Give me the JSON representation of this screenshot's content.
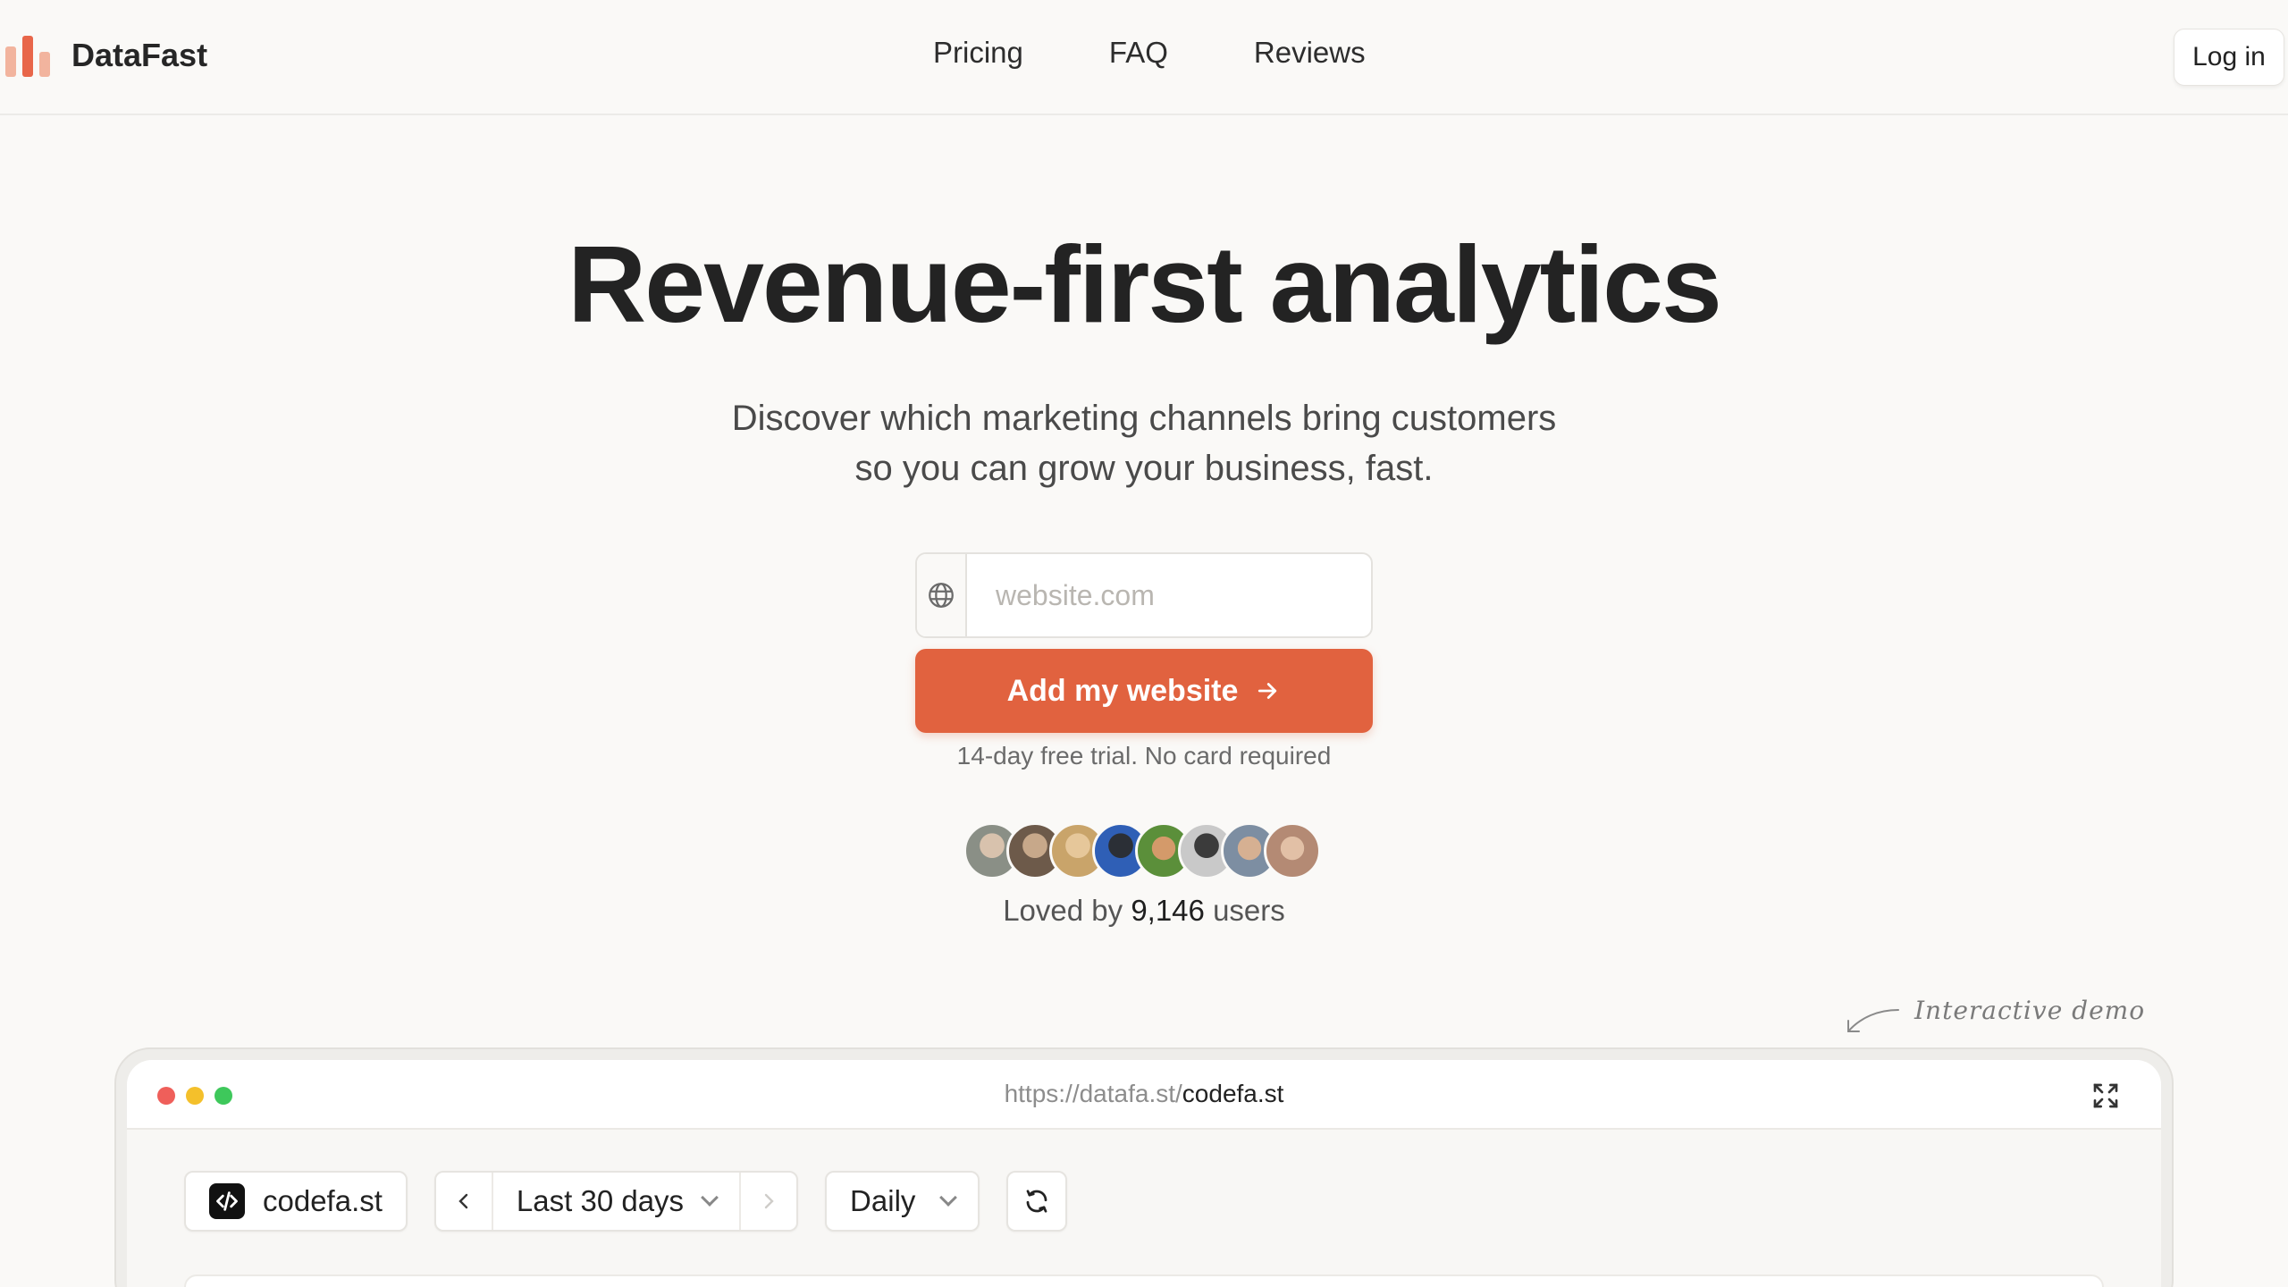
{
  "header": {
    "brand": "DataFast",
    "nav": [
      "Pricing",
      "FAQ",
      "Reviews"
    ],
    "login_label": "Log in"
  },
  "hero": {
    "title": "Revenue-first analytics",
    "subtitle_line1": "Discover which marketing channels bring customers",
    "subtitle_line2": "so you can grow your business, fast.",
    "url_placeholder": "website.com",
    "cta_label": "Add my website",
    "trial_note": "14-day free trial. No card required",
    "loved_prefix": "Loved by",
    "loved_count": "9,146",
    "loved_suffix": "users"
  },
  "colors": {
    "accent": "#e1623f",
    "avatar_colors": [
      "#8a8f86",
      "#6d5a4a",
      "#c9a46a",
      "#2f5fb6",
      "#5b8f3a",
      "#6e7078",
      "#7d8ea2",
      "#b48a74"
    ]
  },
  "demo": {
    "label": "Interactive demo",
    "browser_url_base": "https://datafa.st/",
    "browser_url_path": "codefa.st",
    "site_name": "codefa.st",
    "range_label": "Last 30 days",
    "interval_label": "Daily"
  },
  "icons": {
    "globe": "globe-icon",
    "arrow": "arrow-right-icon",
    "expand": "expand-icon",
    "refresh": "refresh-icon"
  }
}
